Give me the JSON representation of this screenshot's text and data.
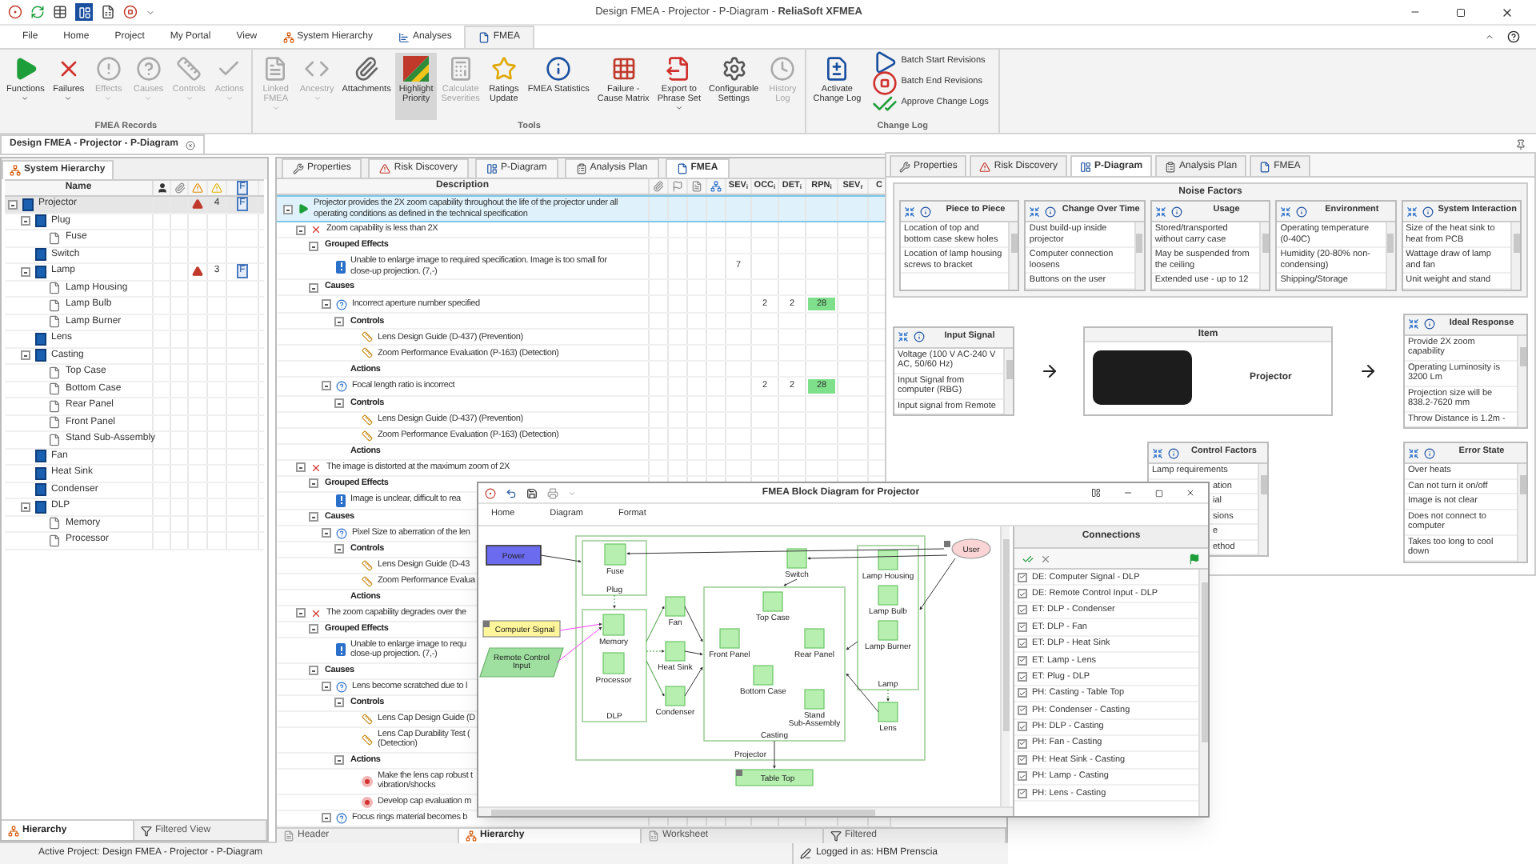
{
  "window": {
    "title": "Design FMEA - Projector - P-Diagram - **ReliaSoft XFMEA**"
  },
  "menu_tabs": [
    {
      "label": "File",
      "kind": "plain",
      "selected": false
    },
    {
      "label": "Home",
      "kind": "plain",
      "selected": false
    },
    {
      "label": "Project",
      "kind": "plain",
      "selected": false
    },
    {
      "label": "My Portal",
      "kind": "plain",
      "selected": false
    },
    {
      "label": "View",
      "kind": "plain",
      "selected": false
    },
    {
      "label": "System Hierarchy",
      "kind": "hierarchy",
      "selected": false
    },
    {
      "label": "Analyses",
      "kind": "analyses",
      "selected": false
    },
    {
      "label": "FMEA",
      "kind": "fmea",
      "selected": true
    }
  ],
  "ribbon": {
    "groups": [
      {
        "title": "FMEA Records",
        "buttons": [
          {
            "label": "Functions",
            "kind": "functions",
            "disabled": false,
            "dropdown": true,
            "selected": false
          },
          {
            "label": "Failures",
            "kind": "failures",
            "disabled": false,
            "dropdown": true,
            "selected": false
          },
          {
            "label": "Effects",
            "kind": "effects",
            "disabled": true,
            "dropdown": true,
            "selected": false
          },
          {
            "label": "Causes",
            "kind": "causes",
            "disabled": true,
            "dropdown": true,
            "selected": false
          },
          {
            "label": "Controls",
            "kind": "controls",
            "disabled": true,
            "dropdown": true,
            "selected": false
          },
          {
            "label": "Actions",
            "kind": "actions",
            "disabled": true,
            "dropdown": true,
            "selected": false
          }
        ]
      },
      {
        "title": "Tools",
        "buttons": [
          {
            "label": "Linked\nFMEA",
            "kind": "linked",
            "disabled": true,
            "dropdown": true,
            "selected": false
          },
          {
            "label": "Ancestry",
            "kind": "ancestry",
            "disabled": true,
            "dropdown": true,
            "selected": false
          },
          {
            "label": "Attachments",
            "kind": "attachments",
            "disabled": false,
            "dropdown": false,
            "selected": false
          },
          {
            "label": "Highlight\nPriority",
            "kind": "highlight",
            "disabled": false,
            "dropdown": false,
            "selected": true
          },
          {
            "label": "Calculate\nSeverities",
            "kind": "calculate",
            "disabled": true,
            "dropdown": false,
            "selected": false
          },
          {
            "label": "Ratings\nUpdate",
            "kind": "ratings",
            "disabled": false,
            "dropdown": false,
            "selected": false
          },
          {
            "label": "FMEA Statistics",
            "kind": "statistics",
            "disabled": false,
            "dropdown": false,
            "selected": false
          },
          {
            "label": "Failure -\nCause Matrix",
            "kind": "matrix",
            "disabled": false,
            "dropdown": false,
            "selected": false
          },
          {
            "label": "Export to\nPhrase Set",
            "kind": "export",
            "disabled": false,
            "dropdown": true,
            "selected": false
          },
          {
            "label": "Configurable\nSettings",
            "kind": "settings",
            "disabled": false,
            "dropdown": false,
            "selected": false
          },
          {
            "label": "History\nLog",
            "kind": "history",
            "disabled": true,
            "dropdown": false,
            "selected": false
          }
        ]
      },
      {
        "title": "Change Log",
        "buttons": [
          {
            "label": "Activate\nChange Log",
            "kind": "activate",
            "disabled": false,
            "dropdown": false,
            "selected": false
          }
        ],
        "small_buttons": [
          {
            "label": "Batch Start Revisions",
            "kind": "start"
          },
          {
            "label": "Batch End Revisions",
            "kind": "end"
          },
          {
            "label": "Approve Change Logs",
            "kind": "approve"
          }
        ]
      }
    ]
  },
  "document_tab": {
    "label": "Design FMEA - Projector - P-Diagram"
  },
  "hierarchy_panel": {
    "tab": "System Hierarchy",
    "columns": [
      "Name",
      "F"
    ],
    "items": [
      {
        "kind": "system",
        "name": "Projector",
        "selected": true,
        "expanded": true,
        "risks": "4",
        "fmea": "F",
        "children": [
          {
            "kind": "system",
            "name": "Plug",
            "selected": false,
            "expanded": true,
            "children": [
              {
                "kind": "component",
                "name": "Fuse",
                "selected": false
              }
            ]
          },
          {
            "kind": "system",
            "name": "Switch",
            "selected": false
          },
          {
            "kind": "system",
            "name": "Lamp",
            "selected": false,
            "expanded": true,
            "risks": "3",
            "fmea": "F",
            "children": [
              {
                "kind": "component",
                "name": "Lamp Housing",
                "selected": false
              },
              {
                "kind": "component",
                "name": "Lamp Bulb",
                "selected": false
              },
              {
                "kind": "component",
                "name": "Lamp Burner",
                "selected": false
              }
            ]
          },
          {
            "kind": "system",
            "name": "Lens",
            "selected": false
          },
          {
            "kind": "system",
            "name": "Casting",
            "selected": false,
            "expanded": true,
            "children": [
              {
                "kind": "component",
                "name": "Top Case",
                "selected": false
              },
              {
                "kind": "component",
                "name": "Bottom Case",
                "selected": false
              },
              {
                "kind": "component",
                "name": "Rear Panel",
                "selected": false
              },
              {
                "kind": "component",
                "name": "Front Panel",
                "selected": false
              },
              {
                "kind": "component",
                "name": "Stand Sub-Assembly",
                "selected": false
              }
            ]
          },
          {
            "kind": "system",
            "name": "Fan",
            "selected": false
          },
          {
            "kind": "system",
            "name": "Heat Sink",
            "selected": false
          },
          {
            "kind": "system",
            "name": "Condenser",
            "selected": false
          },
          {
            "kind": "system",
            "name": "DLP",
            "selected": false,
            "expanded": true,
            "children": [
              {
                "kind": "component",
                "name": "Memory",
                "selected": false
              },
              {
                "kind": "component",
                "name": "Processor",
                "selected": false
              }
            ]
          }
        ]
      }
    ],
    "bottom_tabs": [
      {
        "label": "Hierarchy",
        "kind": "hierarchy",
        "selected": true
      },
      {
        "label": "Filtered View",
        "kind": "filter",
        "selected": false
      }
    ]
  },
  "fmea_panel": {
    "tabs": [
      {
        "label": "Properties",
        "kind": "properties",
        "selected": false
      },
      {
        "label": "Risk Discovery",
        "kind": "risk",
        "selected": false
      },
      {
        "label": "P-Diagram",
        "kind": "pdiagram",
        "selected": false
      },
      {
        "label": "Analysis Plan",
        "kind": "plan",
        "selected": false
      },
      {
        "label": "FMEA",
        "kind": "fmea",
        "selected": true
      }
    ],
    "columns": [
      "Description",
      "SEV$_{i}$",
      "OCC$_{i}$",
      "DET$_{i}$",
      "RPN$_{i}$",
      "SEV$_{r}$",
      "C"
    ],
    "tree": [
      {
        "kind": "function",
        "text": "Projector provides the 2X zoom capability throughout the life of the projector under all operating conditions as defined in the technical specification",
        "selected": true,
        "expanded": true,
        "children": [
          {
            "kind": "failure",
            "text": "Zoom capability is less than 2X",
            "selected": false,
            "expanded": true,
            "children": [
              {
                "kind": "group",
                "text": "Grouped Effects",
                "selected": false,
                "expanded": true,
                "children": [
                  {
                    "kind": "effect",
                    "text": "Unable to enlarge image to required specification. Image is too small for\nclose-up projection.  (7,-)",
                    "selected": false,
                    "sev": "7"
                  }
                ]
              },
              {
                "kind": "group",
                "text": "Causes",
                "selected": false,
                "expanded": true,
                "children": [
                  {
                    "kind": "cause",
                    "text": "Incorrect aperture number specified",
                    "selected": false,
                    "occ": "2",
                    "det": "2",
                    "rpn": "28",
                    "expanded": true,
                    "children": [
                      {
                        "kind": "group",
                        "text": "Controls",
                        "selected": false,
                        "expanded": true,
                        "children": [
                          {
                            "kind": "control",
                            "text": "Lens Design Guide (D-437) (Prevention)",
                            "selected": false
                          },
                          {
                            "kind": "control",
                            "text": "Zoom Performance Evaluation (P-163) (Detection)",
                            "selected": false
                          }
                        ]
                      },
                      {
                        "kind": "group",
                        "text": "Actions",
                        "selected": false
                      }
                    ]
                  },
                  {
                    "kind": "cause",
                    "text": "Focal length ratio is incorrect",
                    "selected": false,
                    "occ": "2",
                    "det": "2",
                    "rpn": "28",
                    "expanded": true,
                    "children": [
                      {
                        "kind": "group",
                        "text": "Controls",
                        "selected": false,
                        "expanded": true,
                        "children": [
                          {
                            "kind": "control",
                            "text": "Lens Design Guide (D-437) (Prevention)",
                            "selected": false
                          },
                          {
                            "kind": "control",
                            "text": "Zoom Performance Evaluation (P-163) (Detection)",
                            "selected": false
                          }
                        ]
                      },
                      {
                        "kind": "group",
                        "text": "Actions",
                        "selected": false
                      }
                    ]
                  }
                ]
              }
            ]
          },
          {
            "kind": "failure",
            "text": "The image is distorted at the maximum zoom of 2X",
            "selected": false,
            "expanded": true,
            "children": [
              {
                "kind": "group",
                "text": "Grouped Effects",
                "selected": false,
                "expanded": true,
                "children": [
                  {
                    "kind": "effect",
                    "text": "Image is unclear, difficult to rea",
                    "selected": false
                  }
                ]
              },
              {
                "kind": "group",
                "text": "Causes",
                "selected": false,
                "expanded": true,
                "children": [
                  {
                    "kind": "cause",
                    "text": "Pixel Size to aberration of the len",
                    "selected": false,
                    "expanded": true,
                    "children": [
                      {
                        "kind": "group",
                        "text": "Controls",
                        "selected": false,
                        "expanded": true,
                        "children": [
                          {
                            "kind": "control",
                            "text": "Lens Design Guide (D-43",
                            "selected": false
                          },
                          {
                            "kind": "control",
                            "text": "Zoom Performance Evalua",
                            "selected": false
                          }
                        ]
                      },
                      {
                        "kind": "group",
                        "text": "Actions",
                        "selected": false
                      }
                    ]
                  }
                ]
              }
            ]
          },
          {
            "kind": "failure",
            "text": "The zoom capability degrades over the",
            "selected": false,
            "expanded": true,
            "children": [
              {
                "kind": "group",
                "text": "Grouped Effects",
                "selected": false,
                "expanded": true,
                "children": [
                  {
                    "kind": "effect",
                    "text": "Unable to enlarge image to requ\nclose-up projection.  (7,-)",
                    "selected": false
                  }
                ]
              },
              {
                "kind": "group",
                "text": "Causes",
                "selected": false,
                "expanded": true,
                "children": [
                  {
                    "kind": "cause",
                    "text": "Lens become scratched due to l",
                    "selected": false,
                    "expanded": true,
                    "children": [
                      {
                        "kind": "group",
                        "text": "Controls",
                        "selected": false,
                        "expanded": true,
                        "children": [
                          {
                            "kind": "control",
                            "text": "Lens Cap Design Guide (D",
                            "selected": false
                          },
                          {
                            "kind": "control",
                            "text": "Lens Cap Durability Test (\n(Detection)",
                            "selected": false
                          }
                        ]
                      },
                      {
                        "kind": "group",
                        "text": "Actions",
                        "selected": false,
                        "expanded": true,
                        "children": [
                          {
                            "kind": "action",
                            "text": "Make the lens cap robust t\nvibration/shocks",
                            "selected": false
                          },
                          {
                            "kind": "action",
                            "text": "Develop cap evaluation m",
                            "selected": false
                          }
                        ]
                      }
                    ]
                  },
                  {
                    "kind": "cause",
                    "text": "Focus rings material becomes b",
                    "selected": false,
                    "expanded": true
                  }
                ]
              }
            ]
          }
        ]
      }
    ],
    "bottom_tabs": [
      {
        "label": "Header",
        "kind": "header",
        "selected": false
      },
      {
        "label": "Hierarchy",
        "kind": "hierarchy",
        "selected": true
      },
      {
        "label": "Worksheet",
        "kind": "worksheet",
        "selected": false
      },
      {
        "label": "Filtered",
        "kind": "filter",
        "selected": false
      }
    ]
  },
  "p_diagram": {
    "tabs": [
      {
        "label": "Properties",
        "kind": "properties",
        "selected": false
      },
      {
        "label": "Risk Discovery",
        "kind": "risk",
        "selected": false
      },
      {
        "label": "P-Diagram",
        "kind": "pdiagram",
        "selected": true
      },
      {
        "label": "Analysis Plan",
        "kind": "plan",
        "selected": false
      },
      {
        "label": "FMEA",
        "kind": "fmea",
        "selected": false
      }
    ],
    "noise_factors": {
      "title": "Noise Factors",
      "boxes": [
        {
          "title": "Piece to Piece",
          "items": [
            "Location of top and bottom case skew holes",
            "Location of lamp housing screws to bracket"
          ]
        },
        {
          "title": "Change Over Time",
          "items": [
            "Dust build-up inside projector",
            "Computer connection loosens",
            "Buttons on the user"
          ]
        },
        {
          "title": "Usage",
          "items": [
            "Stored/transported without carry case",
            "May be suspended from the ceiling",
            "Extended use - up to 12"
          ]
        },
        {
          "title": "Environment",
          "items": [
            "Operating temperature (0-40C)",
            "Humidity (20-80% non-condensing)",
            "Shipping/Storage"
          ]
        },
        {
          "title": "System Interaction",
          "items": [
            "Size of the heat sink to heat from PCB",
            "Wattage draw of lamp and fan",
            "Unit weight and stand"
          ]
        }
      ]
    },
    "input_signal": {
      "title": "Input Signal",
      "items": [
        "Voltage (100 V AC-240 V AC, 50/60 Hz)",
        "Input Signal from computer (RBG)",
        "Input signal from Remote"
      ]
    },
    "item": {
      "title": "Item",
      "name": "Projector"
    },
    "ideal_response": {
      "title": "Ideal Response",
      "items": [
        "Provide 2X zoom capability",
        "Operating Luminosity is 3200 Lm",
        "Projection size will be 838.2-7620 mm",
        "Throw Distance is 1.2m -"
      ]
    },
    "control_factors": {
      "title": "Control Factors",
      "items": [
        "Lamp requirements",
        "ation",
        "ial",
        "sions",
        "e",
        "ethod"
      ]
    },
    "error_state": {
      "title": "Error State",
      "items": [
        "Over heats",
        "Can not turn it on/off",
        "Image is not clear",
        "Does not connect to computer",
        "Takes too long to cool down"
      ]
    }
  },
  "block_diagram": {
    "title": "FMEA Block Diagram for Projector",
    "menu": [
      "Home",
      "Diagram",
      "Format"
    ],
    "nodes": [
      {
        "label": "User",
        "kind": "user"
      },
      {
        "label": "Power",
        "kind": "external"
      },
      {
        "label": "Fuse",
        "kind": "block"
      },
      {
        "label": "Switch",
        "kind": "block"
      },
      {
        "label": "Lamp Housing",
        "kind": "block"
      },
      {
        "label": "Plug",
        "kind": "container"
      },
      {
        "label": "Lamp Bulb",
        "kind": "block"
      },
      {
        "label": "Top Case",
        "kind": "block"
      },
      {
        "label": "Fan",
        "kind": "block"
      },
      {
        "label": "Computer Signal",
        "kind": "signal"
      },
      {
        "label": "Memory",
        "kind": "block"
      },
      {
        "label": "Lamp Burner",
        "kind": "block"
      },
      {
        "label": "Front Panel",
        "kind": "block"
      },
      {
        "label": "Rear Panel",
        "kind": "block"
      },
      {
        "label": "Remote Control Input",
        "kind": "input"
      },
      {
        "label": "Heat Sink",
        "kind": "block"
      },
      {
        "label": "Processor",
        "kind": "block"
      },
      {
        "label": "Lamp",
        "kind": "container"
      },
      {
        "label": "Bottom Case",
        "kind": "block"
      },
      {
        "label": "Condenser",
        "kind": "block"
      },
      {
        "label": "DLP",
        "kind": "container"
      },
      {
        "label": "Stand Sub-Assembly",
        "kind": "block"
      },
      {
        "label": "Lens",
        "kind": "block"
      },
      {
        "label": "Casting",
        "kind": "container"
      },
      {
        "label": "Projector",
        "kind": "container"
      },
      {
        "label": "Table Top",
        "kind": "output"
      }
    ],
    "connections": {
      "title": "Connections",
      "items": [
        {
          "label": "DE: Computer Signal - DLP",
          "checked": true
        },
        {
          "label": "DE: Remote Control Input - DLP",
          "checked": true
        },
        {
          "label": "ET: DLP - Condenser",
          "checked": true
        },
        {
          "label": "ET: DLP - Fan",
          "checked": true
        },
        {
          "label": "ET: DLP - Heat Sink",
          "checked": true
        },
        {
          "label": "ET: Lamp - Lens",
          "checked": true
        },
        {
          "label": "ET: Plug - DLP",
          "checked": true
        },
        {
          "label": "PH: Casting - Table Top",
          "checked": true
        },
        {
          "label": "PH: Condenser - Casting",
          "checked": true
        },
        {
          "label": "PH: DLP - Casting",
          "checked": true
        },
        {
          "label": "PH: Fan - Casting",
          "checked": true
        },
        {
          "label": "PH: Heat Sink - Casting",
          "checked": true
        },
        {
          "label": "PH: Lamp - Casting",
          "checked": true
        },
        {
          "label": "PH: Lens - Casting",
          "checked": true
        }
      ]
    }
  },
  "status_bar": {
    "project": "Active Project: Design FMEA - Projector - P-Diagram",
    "user": "Logged in as: HBM Prenscia"
  }
}
